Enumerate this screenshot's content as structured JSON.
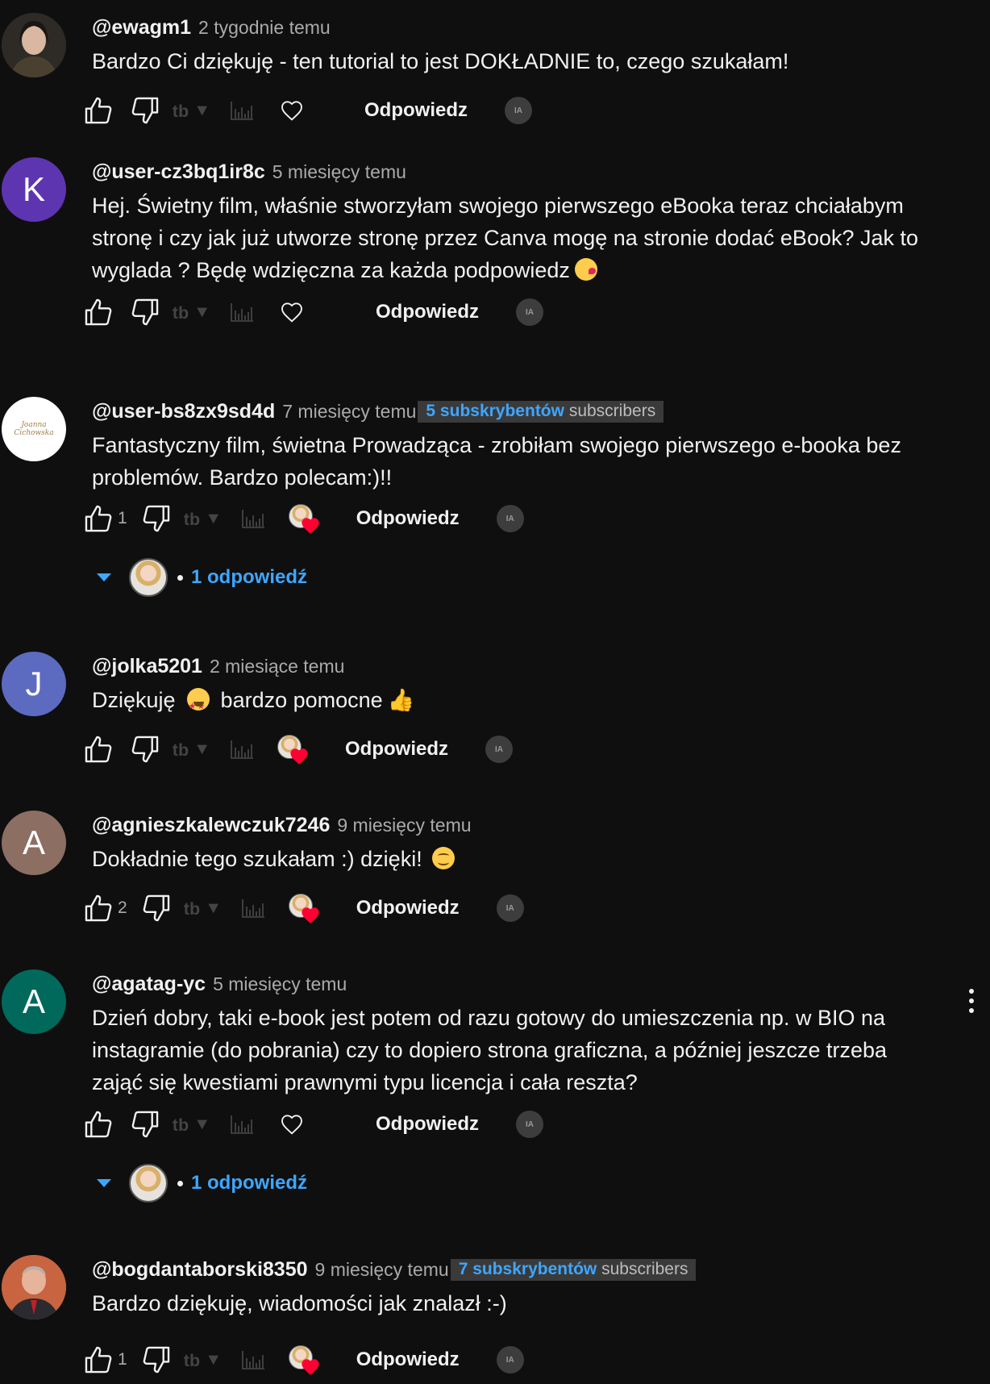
{
  "labels": {
    "reply": "Odpowiedz",
    "subs_suffix": "subscribers",
    "ia": "IA"
  },
  "comments": [
    {
      "author": "@ewagm1",
      "time": "2 tygodnie temu",
      "text": "Bardzo Ci dziękuję - ten tutorial to jest DOKŁADNIE to, czego szukałam!",
      "likes": "",
      "avatar_letter": "",
      "avatar_color": "#6b5a4a"
    },
    {
      "author": "@user-cz3bq1ir8c",
      "time": "5 miesięcy temu",
      "text": "Hej. Świetny film, właśnie stworzyłam swojego pierwszego eBooka teraz chciałabym stronę i czy jak już utworze stronę przez Canva mogę na stronie dodać eBook? Jak to wyglada ? Będę wdzięczna za każda podpowiedz",
      "likes": "",
      "avatar_letter": "K",
      "avatar_color": "#5e35b1"
    },
    {
      "author": "@user-bs8zx9sd4d",
      "time": "7 miesięcy temu",
      "subs_count": "5 subskrybentów",
      "text": "Fantastyczny film, świetna Prowadząca - zrobiłam swojego pierwszego e-booka bez problemów. Bardzo polecam:)!!",
      "likes": "1",
      "avatar_letter": "",
      "avatar_color": "#ffffff",
      "avatar_logo_text": "Joanna Cichowska",
      "replies": "1 odpowiedź"
    },
    {
      "author": "@jolka5201",
      "time": "2 miesiące temu",
      "text_a": "Dziękuję",
      "text_b": "bardzo pomocne",
      "likes": "",
      "avatar_letter": "J",
      "avatar_color": "#5c6bc0"
    },
    {
      "author": "@agnieszkalewczuk7246",
      "time": "9 miesięcy temu",
      "text": "Dokładnie tego szukałam :) dzięki!",
      "likes": "2",
      "avatar_letter": "A",
      "avatar_color": "#8d6e63"
    },
    {
      "author": "@agatag-yc",
      "time": "5 miesięcy temu",
      "text": "Dzień dobry, taki e-book jest potem od razu gotowy do umieszczenia np. w BIO na instagramie (do pobrania) czy to dopiero strona graficzna, a później jeszcze trzeba zająć się kwestiami prawnymi typu licencja i cała reszta?",
      "likes": "",
      "avatar_letter": "A",
      "avatar_color": "#00695c",
      "replies": "1 odpowiedź"
    },
    {
      "author": "@bogdantaborski8350",
      "time": "9 miesięcy temu",
      "subs_count": "7 subskrybentów",
      "text": "Bardzo dziękuję, wiadomości jak znalazł  :-)",
      "likes": "1",
      "avatar_letter": "",
      "avatar_color": "#c56a4a"
    }
  ],
  "colors": {
    "background": "#0f0f0f",
    "accent_blue": "#3ea6ff",
    "heart_red": "#ff0033"
  }
}
